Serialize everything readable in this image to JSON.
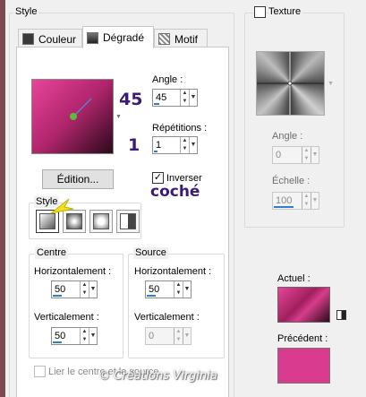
{
  "style_group": {
    "title": "Style"
  },
  "tabs": [
    {
      "label": "Couleur",
      "icon": "solid-color-icon",
      "active": false
    },
    {
      "label": "Dégradé",
      "icon": "gradient-icon",
      "active": true
    },
    {
      "label": "Motif",
      "icon": "pattern-icon",
      "active": false
    }
  ],
  "gradient": {
    "colors": {
      "start": "#e8449a",
      "mid": "#b0256c",
      "end": "#2a0a1a",
      "handle": "#5dbb3a"
    },
    "angle_label": "Angle :",
    "angle_value": "45",
    "angle_annotation": "45",
    "repetitions_label": "Répétitions :",
    "repetitions_value": "1",
    "repetitions_annotation": "1",
    "edit_button": "Édition...",
    "invert_label": "Inverser",
    "invert_checked": true,
    "invert_annotation": "coché",
    "style_group_title": "Style",
    "style_types": [
      "linear",
      "radial",
      "sunburst",
      "rectangular"
    ],
    "selected_style": "linear"
  },
  "centre": {
    "title": "Centre",
    "horizontal_label": "Horizontalement :",
    "horizontal_value": "50",
    "vertical_label": "Verticalement :",
    "vertical_value": "50"
  },
  "source": {
    "title": "Source",
    "horizontal_label": "Horizontalement :",
    "horizontal_value": "50",
    "vertical_label": "Verticalement :",
    "vertical_value": "0"
  },
  "link_checkbox": {
    "label": "Lier le centre et la source",
    "checked": false,
    "enabled": false
  },
  "texture": {
    "label": "Texture",
    "checked": false,
    "angle_label": "Angle :",
    "angle_value": "0",
    "scale_label": "Échelle :",
    "scale_value": "100"
  },
  "current": {
    "label": "Actuel :"
  },
  "previous": {
    "label": "Précédent :",
    "color": "#d93c8f"
  },
  "watermark": "© Créations Virginia"
}
